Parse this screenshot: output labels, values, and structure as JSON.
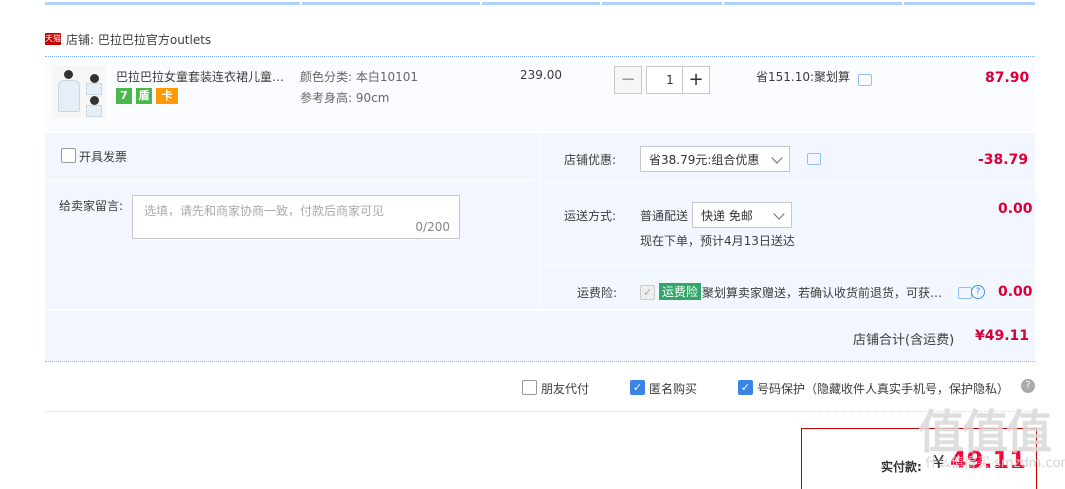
{
  "shop": {
    "platform_badge": "天猫",
    "label": "店铺: 巴拉巴拉官方outlets"
  },
  "item": {
    "title": "巴拉巴拉女童套装连衣裙儿童裙子夏装",
    "color_label": "颜色分类: 本白10101",
    "height_label": "参考身高: 90cm",
    "service_icons": [
      {
        "text": "7",
        "color": "#4bb84b"
      },
      {
        "text": "盾",
        "color": "#4bb84b"
      },
      {
        "text": "卡",
        "color": "#ff9900"
      }
    ],
    "price": "239.00",
    "quantity": "1",
    "qty_minus": "−",
    "qty_plus": "+",
    "saving": "省151.10:聚划算",
    "subtotal": "87.90"
  },
  "invoice": {
    "label": "开具发票"
  },
  "message": {
    "label": "给卖家留言:",
    "placeholder": "选填，请先和商家协商一致，付款后商家可见",
    "counter": "0/200"
  },
  "discount": {
    "label": "店铺优惠:",
    "selected": "省38.79元:组合优惠",
    "amount": "-38.79"
  },
  "shipping": {
    "label": "运送方式:",
    "method": "普通配送",
    "selected": "快递 免邮",
    "eta": "现在下单，预计4月13日送达",
    "amount": "0.00"
  },
  "insurance": {
    "label": "运费险:",
    "tag": "运费险",
    "text": "聚划算卖家赠送，若确认收货前退货，可获…",
    "amount": "0.00",
    "help": "?"
  },
  "store_total": {
    "label": "店铺合计(含运费)",
    "amount": "¥49.11"
  },
  "options": [
    {
      "label": "朋友代付",
      "checked": false
    },
    {
      "label": "匿名购买",
      "checked": true
    },
    {
      "label": "号码保护（隐藏收件人真实手机号，保护隐私）",
      "checked": true
    }
  ],
  "options_help": "?",
  "pay": {
    "label": "实付款:",
    "currency": "¥",
    "amount": "49.11"
  },
  "watermark": {
    "logo": "值值值",
    "text": "什么值得买 smzdm.com"
  },
  "colors": {
    "accent_red": "#d90037",
    "border_blue": "#80b2ff",
    "panel_bg": "#f2f7ff"
  }
}
